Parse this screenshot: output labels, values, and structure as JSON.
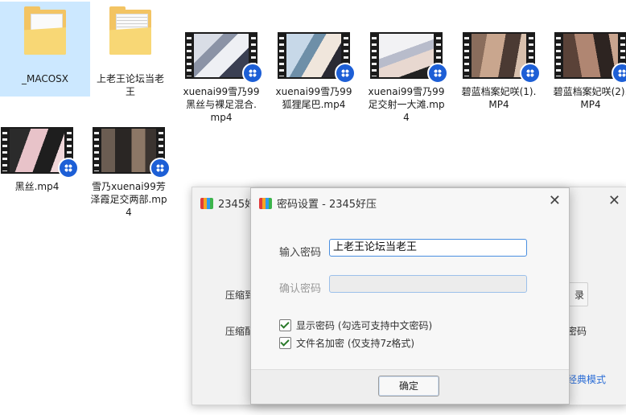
{
  "files": [
    {
      "name": "_MACOSX",
      "type": "folder",
      "selected": true
    },
    {
      "name": "上老王论坛当老王",
      "type": "folder",
      "selected": false
    },
    {
      "name": "xuenai99雪乃99黑丝与裸足混合.mp4",
      "type": "video"
    },
    {
      "name": "xuenai99雪乃99狐狸尾巴.mp4",
      "type": "video"
    },
    {
      "name": "xuenai99雪乃99足交射一大滩.mp4",
      "type": "video"
    },
    {
      "name": "碧蓝档案妃咲(1).MP4",
      "type": "video"
    },
    {
      "name": "碧蓝档案妃咲(2).MP4",
      "type": "video"
    },
    {
      "name": "黑丝.mp4",
      "type": "video"
    },
    {
      "name": "雪乃xuenai99芳泽霞足交两部.mp4",
      "type": "video"
    }
  ],
  "background_window": {
    "title": "2345好压",
    "close_icon": "close-icon",
    "label_compress_partial": "压缩到",
    "label_compress_mode_partial": "压缩配",
    "browse_partial": "录",
    "password_partial": "密码",
    "classic_mode_link": "经典模式"
  },
  "dialog": {
    "title": "密码设置 - 2345好压",
    "password_label": "输入密码",
    "password_value": "上老王论坛当老王",
    "confirm_label": "确认密码",
    "confirm_value": "",
    "show_password_label": "显示密码 (勾选可支持中文密码)",
    "show_password_checked": true,
    "encrypt_names_label": "文件名加密  (仅支持7z格式)",
    "encrypt_names_checked": true,
    "ok_label": "确定"
  },
  "colors": {
    "accent": "#4a8fe0",
    "selection": "#cce8ff",
    "folder": "#f3c463",
    "link": "#2a6cd6"
  }
}
